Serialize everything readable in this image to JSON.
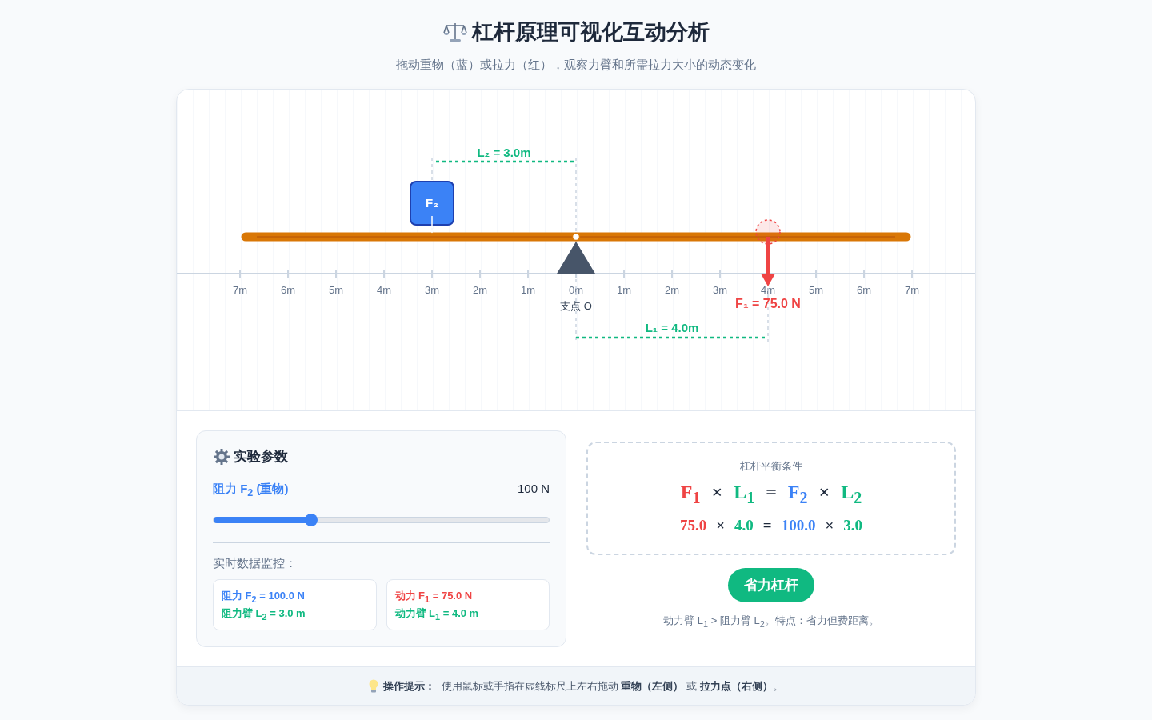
{
  "header": {
    "title": "杠杆原理可视化互动分析",
    "subtitle": "拖动重物（蓝）或拉力（红），观察力臂和所需拉力大小的动态变化"
  },
  "canvas": {
    "ruler_labels": [
      "7m",
      "6m",
      "5m",
      "4m",
      "3m",
      "2m",
      "1m",
      "0m",
      "1m",
      "2m",
      "3m",
      "4m",
      "5m",
      "6m",
      "7m"
    ],
    "fulcrum_label": "支点 O",
    "weight_label": "F₂",
    "effort_arm_label": "L₁ = 4.0m",
    "load_arm_label": "L₂ = 3.0m",
    "effort_label": "F₁ = 75.0 N"
  },
  "parameters": {
    "title": "实验参数",
    "slider": {
      "label": "阻力 F$_{2}$ (重物)",
      "reading": "100 N",
      "level": 0.29
    },
    "monitor_title": "实时数据监控：",
    "monitor_cards": [
      {
        "lines": [
          {
            "text": "阻力 F$_{2}$ = 100.0 N",
            "color": "#3b82f6"
          },
          {
            "text": "阻力臂 L$_{2}$ = 3.0 m",
            "color": "#10b981"
          }
        ]
      },
      {
        "lines": [
          {
            "text": "动力 F$_{1}$ = 75.0 N",
            "color": "#ef4444"
          },
          {
            "text": "动力臂 L$_{1}$ = 4.0 m",
            "color": "#10b981"
          }
        ]
      }
    ]
  },
  "balance": {
    "title": "杠杆平衡条件",
    "formula": [
      {
        "text": "F$_{1}$",
        "color": "#ef4444"
      },
      {
        "text": "×",
        "color": "#1e293b"
      },
      {
        "text": "L$_{1}$",
        "color": "#10b981"
      },
      {
        "text": "=",
        "color": "#1e293b"
      },
      {
        "text": "F$_{2}$",
        "color": "#3b82f6"
      },
      {
        "text": "×",
        "color": "#1e293b"
      },
      {
        "text": "L$_{2}$",
        "color": "#10b981"
      }
    ],
    "values": [
      {
        "text": "75.0",
        "color": "#ef4444"
      },
      {
        "text": "×",
        "color": "#1e293b"
      },
      {
        "text": "4.0",
        "color": "#10b981"
      },
      {
        "text": "=",
        "color": "#1e293b"
      },
      {
        "text": "100.0",
        "color": "#3b82f6"
      },
      {
        "text": "×",
        "color": "#1e293b"
      },
      {
        "text": "3.0",
        "color": "#10b981"
      }
    ]
  },
  "result": {
    "badge": "省力杠杆",
    "color": "#10b981",
    "description": "动力臂 L$_{1}$ > 阻力臂 L$_{2}$。特点：省力但费距离。"
  },
  "footer": {
    "tip": "**操作提示：**  使用鼠标或手指在虚线标尺上左右拖动 **重物（左侧）** 或 **拉力点（右侧）**。"
  }
}
